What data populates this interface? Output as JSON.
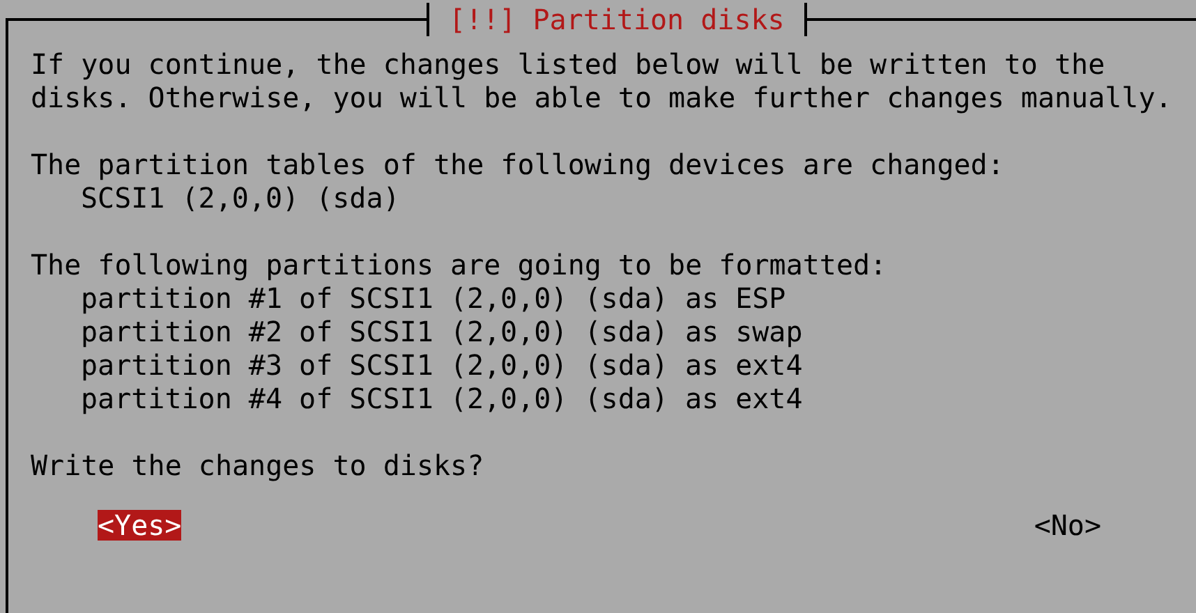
{
  "window": {
    "title": "[!!] Partition disks"
  },
  "paragraphs": [
    {
      "text": "If you continue, the changes listed below will be written to the\ndisks. Otherwise, you will be able to make further changes manually."
    },
    {
      "text": "The partition tables of the following devices are changed:",
      "items": [
        "SCSI1 (2,0,0) (sda)"
      ]
    },
    {
      "text": "The following partitions are going to be formatted:",
      "items": [
        "partition #1 of SCSI1 (2,0,0) (sda) as ESP",
        "partition #2 of SCSI1 (2,0,0) (sda) as swap",
        "partition #3 of SCSI1 (2,0,0) (sda) as ext4",
        "partition #4 of SCSI1 (2,0,0) (sda) as ext4"
      ]
    },
    {
      "text": "Write the changes to disks?"
    }
  ],
  "buttons": [
    {
      "label": "<Yes>",
      "selected": true
    },
    {
      "label": "<No>",
      "selected": false
    }
  ]
}
